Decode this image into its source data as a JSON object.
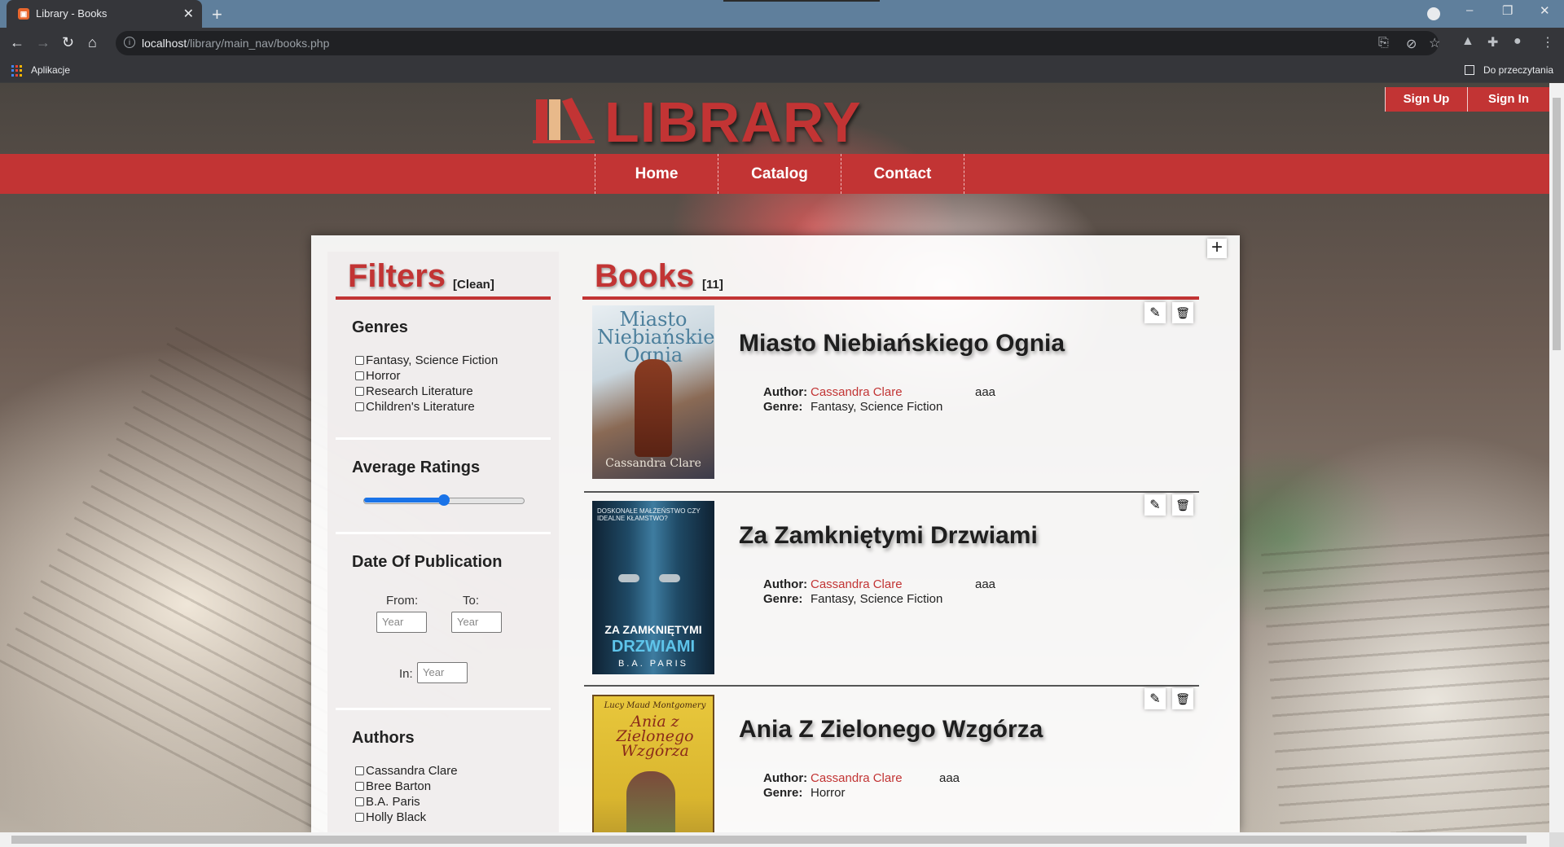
{
  "browser": {
    "tab_title": "Library - Books",
    "favicon_text": "\u0001",
    "url_host": "localhost",
    "url_path": "/library/main_nav/books.php",
    "bookmark_apps": "Aplikacje",
    "reading_list": "Do przeczytania"
  },
  "site": {
    "logo_text": "LIBRARY",
    "sign_up": "Sign Up",
    "sign_in": "Sign In",
    "nav": [
      "Home",
      "Catalog",
      "Contact"
    ],
    "accent_color": "#c23434"
  },
  "filters": {
    "title": "Filters",
    "clean": "[Clean]",
    "genres_title": "Genres",
    "genres": [
      "Fantasy, Science Fiction",
      "Horror",
      "Research Literature",
      "Children's Literature"
    ],
    "ratings_title": "Average Ratings",
    "ratings_value": 0.5,
    "date_title": "Date Of Publication",
    "from_label": "From:",
    "to_label": "To:",
    "in_label": "In:",
    "year_placeholder": "Year",
    "authors_title": "Authors",
    "authors": [
      "Cassandra Clare",
      "Bree Barton",
      "B.A. Paris",
      "Holly Black"
    ]
  },
  "books": {
    "title": "Books",
    "count": "[11]",
    "author_label": "Author:",
    "genre_label": "Genre:",
    "items": [
      {
        "title": "Miasto Niebiańskiego Ognia",
        "author": "Cassandra Clare",
        "genre": "Fantasy, Science Fiction",
        "extra": "aaa",
        "cover_text": "Miasto Niebiańskiego Ognia",
        "cover_author": "Cassandra Clare"
      },
      {
        "title": "Za Zamkniętymi Drzwiami",
        "author": "Cassandra Clare",
        "genre": "Fantasy, Science Fiction",
        "extra": "aaa",
        "cover_line1": "ZA ZAMKNIĘTYMI",
        "cover_line2": "DRZWIAMI",
        "cover_author": "B.A. PARIS",
        "cover_tagline": "DOSKONAŁE MAŁŻEŃSTWO CZY IDEALNE KŁAMSTWO?"
      },
      {
        "title": "Ania Z Zielonego Wzgórza",
        "author": "Cassandra Clare",
        "genre": "Horror",
        "extra": "aaa",
        "cover_author": "Lucy Maud Montgomery",
        "cover_text": "Ania z Zielonego Wzgórza"
      }
    ]
  }
}
